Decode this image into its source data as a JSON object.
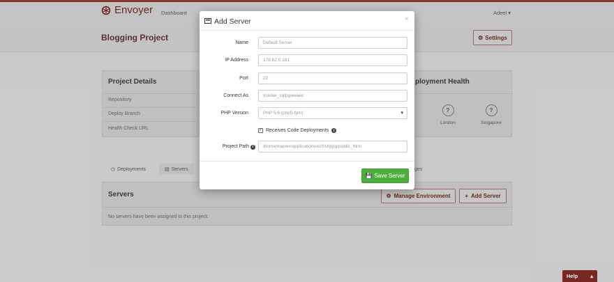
{
  "app": {
    "logo_text": "Envoyer",
    "nav_dashboard": "Dashboard",
    "user_menu": "Adeel ▾"
  },
  "project": {
    "title": "Blogging Project",
    "settings_label": "Settings"
  },
  "details": {
    "title": "Project Details",
    "rows": [
      "Repository",
      "Deploy Branch",
      "Health Check URL"
    ]
  },
  "health": {
    "title": "ployment Health",
    "locations": [
      {
        "symbol": "?",
        "label": "London"
      },
      {
        "symbol": "?",
        "label": "Singapore"
      }
    ]
  },
  "tabs": {
    "deployments": "Deployments",
    "servers": "Servers",
    "hooks_fragment": "ges"
  },
  "servers": {
    "title": "Servers",
    "empty_text": "No servers have been assigned to this project.",
    "manage_label": "Manage Environment",
    "add_label": "Add Server"
  },
  "help": {
    "label": "Help",
    "caret": "▴"
  },
  "modal": {
    "title": "Add Server",
    "close": "×",
    "fields": {
      "name": {
        "label": "Name",
        "value": "Default Server"
      },
      "ip": {
        "label": "IP Address",
        "value": "178.62.0.181"
      },
      "port": {
        "label": "Port",
        "value": "22"
      },
      "connect_as": {
        "label": "Connect As",
        "value": "master_cqtpgweaec"
      },
      "php": {
        "label": "PHP Version",
        "value": "PHP 5.6 (php5-fpm)"
      },
      "path": {
        "label": "Project Path",
        "value": "/home/master/applications/ezfrshjrpg/public_html"
      }
    },
    "receives_label": "Receives Code Deployments",
    "save_label": "Save Server"
  },
  "colors": {
    "brand": "#7c2a24",
    "save": "#4cae3b"
  }
}
